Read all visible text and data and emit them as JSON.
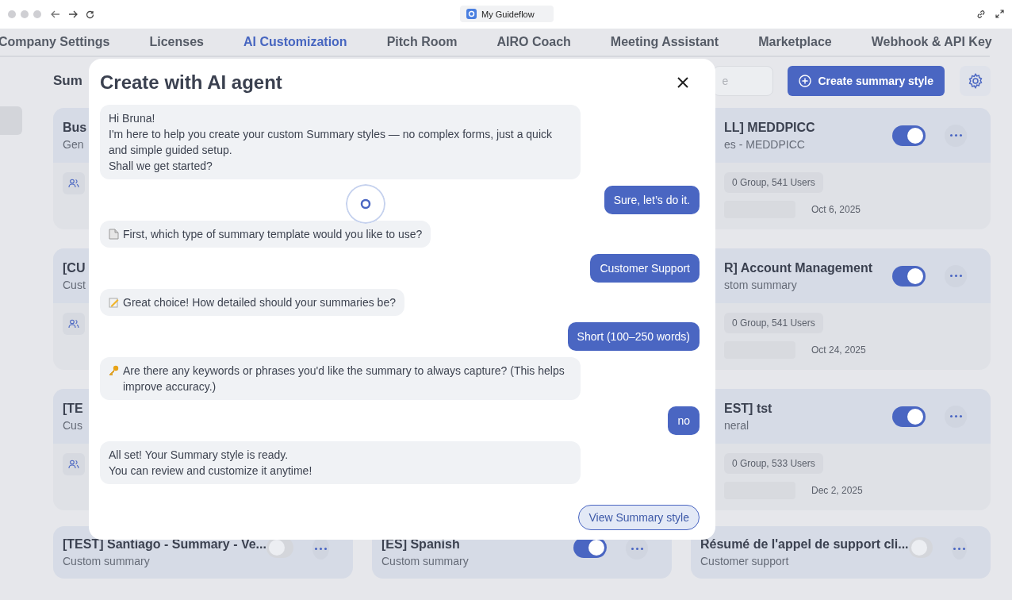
{
  "browser": {
    "title": "My Guideflow"
  },
  "tabs": [
    {
      "label": "Company Settings",
      "selected": false
    },
    {
      "label": "Licenses",
      "selected": false
    },
    {
      "label": "AI Customization",
      "selected": true
    },
    {
      "label": "Pitch Room",
      "selected": false
    },
    {
      "label": "AIRO Coach",
      "selected": false
    },
    {
      "label": "Meeting Assistant",
      "selected": false
    },
    {
      "label": "Marketplace",
      "selected": false
    },
    {
      "label": "Webhook & API Key",
      "selected": false
    }
  ],
  "page": {
    "heading": "Sum",
    "search": {
      "placeholder": "e"
    },
    "create_button": "Create summary style"
  },
  "left_cards": [
    {
      "title": "Bus",
      "subtitle": "Gen"
    },
    {
      "title": "[CU",
      "subtitle": "Cust"
    },
    {
      "title": "[TE",
      "subtitle": "Cus"
    }
  ],
  "right_cards": [
    {
      "title": "LL] MEDDPICC",
      "subtitle": "es - MEDDPICC",
      "users": "0 Group, 541 Users",
      "date": "Oct 6, 2025",
      "on": true
    },
    {
      "title": "R] Account Management",
      "subtitle": "stom summary",
      "users": "0 Group, 541 Users",
      "date": "Oct 24, 2025",
      "on": true
    },
    {
      "title": "EST] tst",
      "subtitle": "neral",
      "users": "0 Group, 533 Users",
      "date": "Dec 2, 2025",
      "on": true
    }
  ],
  "bottom_cards": [
    {
      "title": "[TEST] Santiago - Summary - Ve...",
      "subtitle": "Custom summary",
      "on": false
    },
    {
      "title": "[ES] Spanish",
      "subtitle": "Custom summary",
      "on": true
    },
    {
      "title": "Résumé de l'appel de support cli...",
      "subtitle": "Customer support",
      "on": false
    }
  ],
  "modal": {
    "title": "Create with AI agent",
    "messages": [
      {
        "kind": "bot",
        "lines": [
          "Hi Bruna!",
          "I'm here to help you create your custom Summary styles — no complex forms, just a quick and simple guided setup.",
          "Shall we get started?"
        ]
      },
      {
        "kind": "user",
        "lines": [
          "Sure, let’s do it."
        ]
      },
      {
        "kind": "bot",
        "lines": [
          "First, which type of summary template would you like to use?"
        ]
      },
      {
        "kind": "user",
        "lines": [
          "Customer Support"
        ]
      },
      {
        "kind": "bot",
        "lines": [
          "Great choice! How detailed should your summaries be?"
        ]
      },
      {
        "kind": "user",
        "lines": [
          "Short (100–250 words)"
        ]
      },
      {
        "kind": "bot",
        "lines": [
          "Are there any keywords or phrases you'd like the summary to always capture? (This helps improve accuracy.)"
        ]
      },
      {
        "kind": "user",
        "lines": [
          "no"
        ]
      },
      {
        "kind": "bot",
        "lines": [
          "All set! Your Summary style is ready.",
          "You can review and customize it anytime!"
        ]
      }
    ],
    "action": "View Summary style"
  }
}
